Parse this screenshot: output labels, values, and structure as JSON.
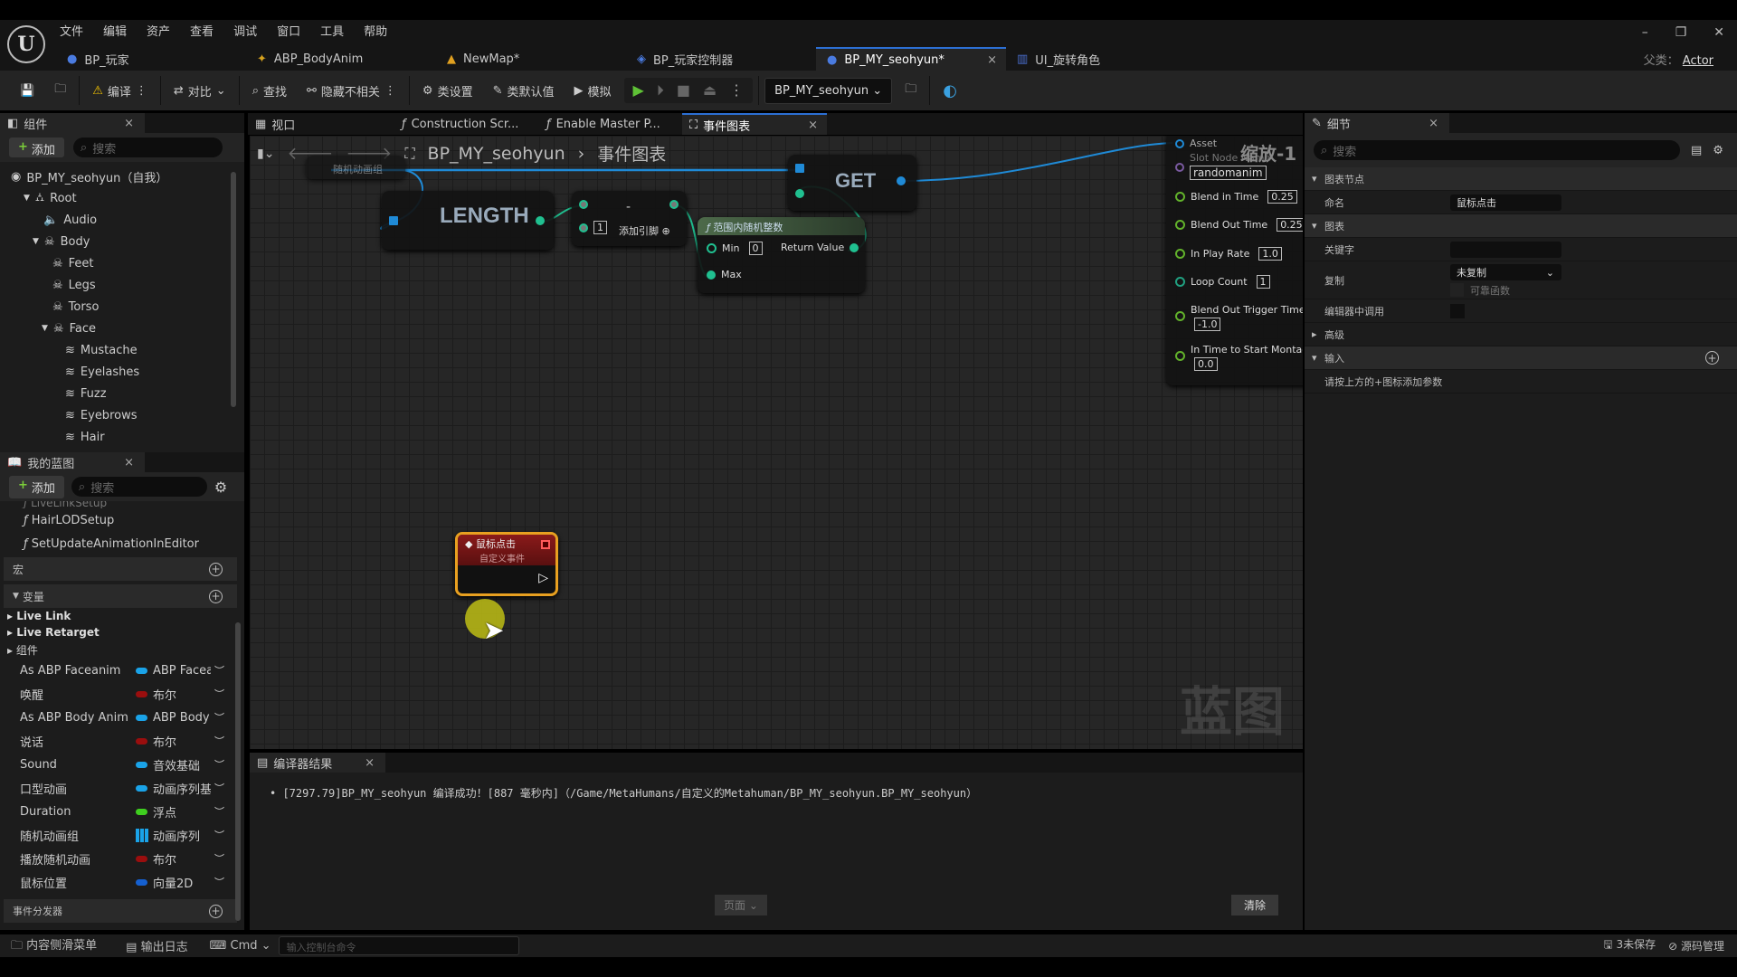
{
  "menu": [
    "文件",
    "编辑",
    "资产",
    "查看",
    "调试",
    "窗口",
    "工具",
    "帮助"
  ],
  "tabs": [
    {
      "label": "BP_玩家",
      "icon": "pawn-icon"
    },
    {
      "label": "ABP_BodyAnim",
      "icon": "anim-blueprint-icon"
    },
    {
      "label": "NewMap*",
      "icon": "level-icon"
    },
    {
      "label": "BP_玩家控制器",
      "icon": "gamepad-icon"
    },
    {
      "label": "BP_MY_seohyun*",
      "icon": "pawn-icon",
      "active": true
    },
    {
      "label": "UI_旋转角色",
      "icon": "widget-icon"
    }
  ],
  "parent_class": {
    "label": "父类：",
    "value": "Actor"
  },
  "toolbar": {
    "compile": "编译",
    "diff": "对比",
    "find": "查找",
    "hide_unrelated": "隐藏不相关",
    "class_settings": "类设置",
    "class_defaults": "类默认值",
    "simulate": "模拟",
    "debug_object": "BP_MY_seohyun"
  },
  "components": {
    "title": "组件",
    "add": "添加",
    "search_placeholder": "搜索",
    "tree": [
      {
        "label": "BP_MY_seohyun（自我）",
        "depth": 0
      },
      {
        "label": "Root",
        "depth": 1,
        "expanded": true
      },
      {
        "label": "Audio",
        "depth": 2
      },
      {
        "label": "Body",
        "depth": 2,
        "expanded": true
      },
      {
        "label": "Feet",
        "depth": 3
      },
      {
        "label": "Legs",
        "depth": 3
      },
      {
        "label": "Torso",
        "depth": 3
      },
      {
        "label": "Face",
        "depth": 3,
        "expanded": true
      },
      {
        "label": "Mustache",
        "depth": 4
      },
      {
        "label": "Eyelashes",
        "depth": 4
      },
      {
        "label": "Fuzz",
        "depth": 4
      },
      {
        "label": "Eyebrows",
        "depth": 4
      },
      {
        "label": "Hair",
        "depth": 4
      }
    ]
  },
  "my_blueprint": {
    "title": "我的蓝图",
    "add": "添加",
    "search_placeholder": "搜索",
    "functions": [
      "LiveLinkSetup",
      "HairLODSetup",
      "SetUpdateAnimationInEditor"
    ],
    "macros": "宏",
    "variables": "变量",
    "categories": [
      "Live Link",
      "Live Retarget",
      "组件"
    ],
    "vars": [
      {
        "name": "As ABP Faceanim",
        "type": "ABP Faceanim",
        "color": "#1aa3e8"
      },
      {
        "name": "唤醒",
        "type": "布尔",
        "color": "#9a0e0e"
      },
      {
        "name": "As ABP Body Anim",
        "type": "ABP Body",
        "color": "#1aa3e8"
      },
      {
        "name": "说话",
        "type": "布尔",
        "color": "#9a0e0e"
      },
      {
        "name": "Sound",
        "type": "音效基础",
        "color": "#1aa3e8"
      },
      {
        "name": "口型动画",
        "type": "动画序列基",
        "color": "#1aa3e8"
      },
      {
        "name": "Duration",
        "type": "浮点",
        "color": "#3fcf1f"
      },
      {
        "name": "随机动画组",
        "type": "动画序列",
        "color": "#1aa3e8",
        "array": true
      },
      {
        "name": "播放随机动画",
        "type": "布尔",
        "color": "#9a0e0e"
      },
      {
        "name": "鼠标位置",
        "type": "向量2D",
        "color": "#1560d0"
      }
    ],
    "dispatchers": "事件分发器"
  },
  "graph_tabs": [
    {
      "label": "视口"
    },
    {
      "label": "Construction Scr..."
    },
    {
      "label": "Enable Master P..."
    },
    {
      "label": "事件图表",
      "active": true
    }
  ],
  "breadcrumb": {
    "blueprint": "BP_MY_seohyun",
    "graph": "事件图表"
  },
  "graph": {
    "zoom": "缩放-1",
    "watermark": "蓝图",
    "var_node": "随机动画组",
    "length": "LENGTH",
    "subtract": {
      "op": "-",
      "value": "1",
      "add_pin": "添加引脚"
    },
    "random": {
      "title": "范围内随机整数",
      "min_label": "Min",
      "min": "0",
      "max_label": "Max",
      "ret": "Return Value"
    },
    "get": "GET",
    "montage": {
      "asset": "Asset",
      "slot_label": "Slot Node Name",
      "slot": "randomanim",
      "rows": [
        {
          "label": "Blend in Time",
          "value": "0.25"
        },
        {
          "label": "Blend Out Time",
          "value": "0.25"
        },
        {
          "label": "In Play Rate",
          "value": "1.0"
        },
        {
          "label": "Loop Count",
          "value": "1"
        },
        {
          "label": "Blend Out Trigger Time",
          "value": "-1.0"
        },
        {
          "label": "In Time to Start Montag",
          "value": "0.0"
        }
      ]
    },
    "event": {
      "title": "鼠标点击",
      "subtitle": "自定义事件"
    }
  },
  "compiler": {
    "title": "编译器结果",
    "log": "[7297.79]BP_MY_seohyun 编译成功！[887 毫秒内]（/Game/MetaHumans/自定义的Metahuman/BP_MY_seohyun.BP_MY_seohyun）",
    "page": "页面",
    "clear": "清除"
  },
  "details": {
    "title": "细节",
    "search_placeholder": "搜索",
    "sec_node": "图表节点",
    "name_label": "命名",
    "name_value": "鼠标点击",
    "sec_graph": "图表",
    "keywords": "关键字",
    "replication": "复制",
    "replication_value": "未复制",
    "reliable": "可靠函数",
    "call_in_editor": "编辑器中调用",
    "advanced": "高级",
    "inputs": "输入",
    "inputs_hint": "请按上方的+图标添加参数"
  },
  "statusbar": {
    "content_drawer": "内容侧滑菜单",
    "output_log": "输出日志",
    "cmd": "Cmd",
    "cmd_placeholder": "输入控制台命令",
    "unsaved": "3未保存",
    "source_control": "源码管理"
  }
}
